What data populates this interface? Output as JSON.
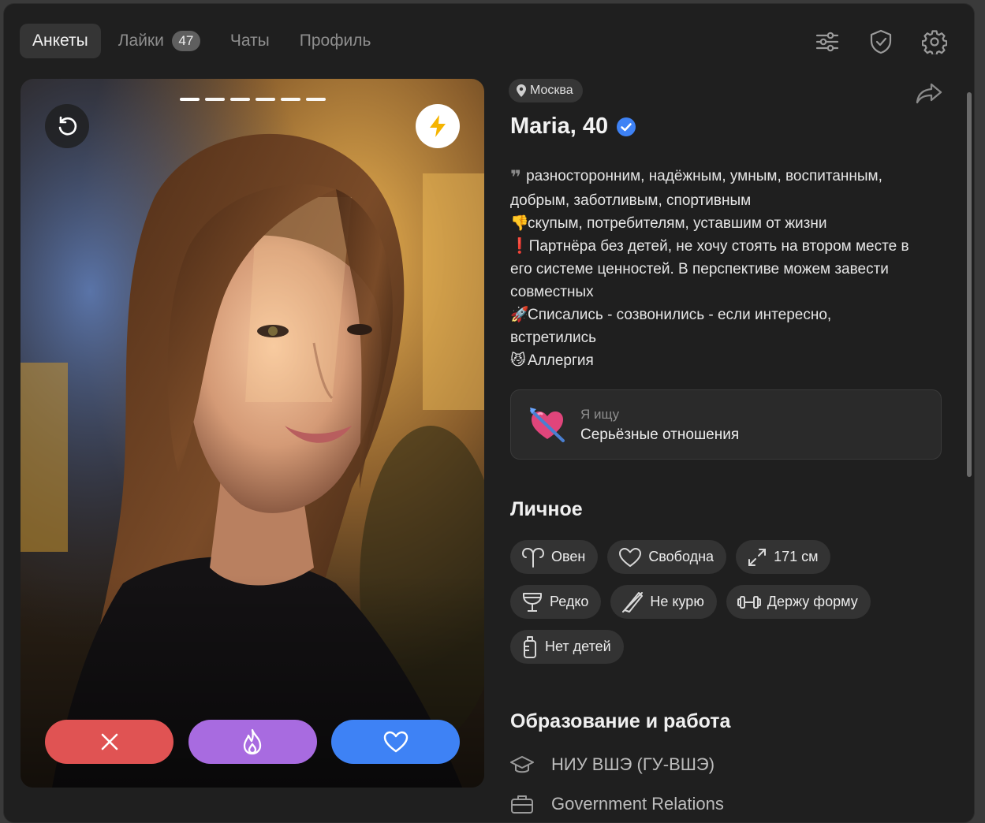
{
  "nav": {
    "tabs": [
      {
        "label": "Анкеты",
        "active": true
      },
      {
        "label": "Лайки",
        "badge": "47"
      },
      {
        "label": "Чаты"
      },
      {
        "label": "Профиль"
      }
    ],
    "icons": [
      "filters-icon",
      "shield-check-icon",
      "gear-icon"
    ]
  },
  "card": {
    "photo_count": 6,
    "current_photo": 1,
    "undo_icon": "undo-icon",
    "boost_icon": "lightning-icon",
    "actions": [
      "dislike-x-icon",
      "superlike-flame-icon",
      "like-heart-icon"
    ],
    "colors": {
      "dislike": "#e05353",
      "superlike": "#a86be0",
      "like": "#3e82f5",
      "boost": "#f5b400"
    }
  },
  "profile": {
    "location": "Москва",
    "name_age": "Maria, 40",
    "verified_color": "#3e82f5",
    "about": [
      {
        "emoji": "",
        "text": "разносторонним, надёжным, умным, воспитанным,"
      },
      {
        "emoji": "",
        "text": "добрым, заботливым, спортивным"
      },
      {
        "emoji": "👎",
        "text": "скупым, потребителям, уставшим от жизни"
      },
      {
        "emoji": "❗",
        "text": "Партнёра без детей, не хочу стоять на втором месте в"
      },
      {
        "emoji": "",
        "text": "его системе ценностей. В перспективе можем завести"
      },
      {
        "emoji": "",
        "text": "совместных"
      },
      {
        "emoji": "🚀",
        "text": "Списались - созвонились - если интересно,"
      },
      {
        "emoji": "",
        "text": "встретились"
      },
      {
        "emoji": "😼",
        "text": "Аллергия"
      }
    ],
    "first_line_glyph": "",
    "looking_for": {
      "label": "Я ищу",
      "value": "Серьёзные отношения",
      "icon": "heart-arrow-icon"
    },
    "personal": {
      "title": "Личное",
      "chips": [
        [
          {
            "icon": "aries-icon",
            "label": "Овен"
          },
          {
            "icon": "heart-outline-icon",
            "label": "Свободна"
          },
          {
            "icon": "expand-arrows-icon",
            "label": "171 см"
          }
        ],
        [
          {
            "icon": "wine-glass-icon",
            "label": "Редко"
          },
          {
            "icon": "no-smoking-icon",
            "label": "Не курю"
          },
          {
            "icon": "dumbbell-icon",
            "label": "Держу форму"
          }
        ],
        [
          {
            "icon": "baby-bottle-icon",
            "label": "Нет детей"
          }
        ]
      ]
    },
    "education": {
      "title": "Образование и работа",
      "items": [
        {
          "icon": "graduation-cap-icon",
          "label": "НИУ ВШЭ (ГУ-ВШЭ)"
        },
        {
          "icon": "briefcase-icon",
          "label": "Government Relations"
        }
      ]
    }
  }
}
